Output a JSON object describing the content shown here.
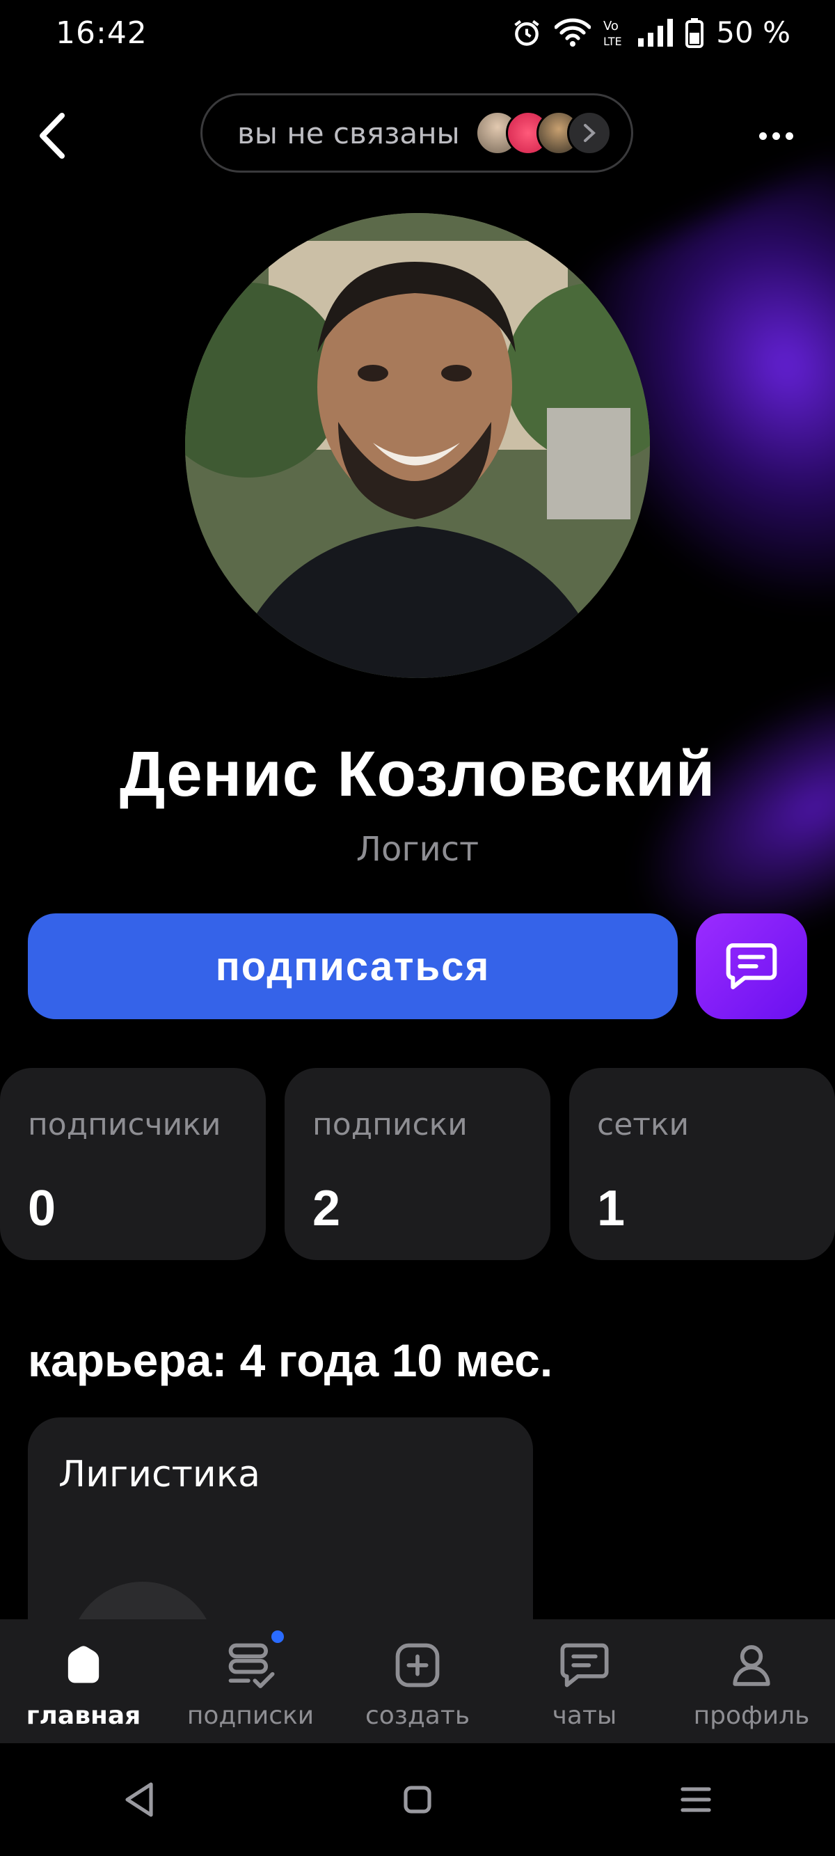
{
  "status_bar": {
    "time": "16:42",
    "battery": "50 %",
    "icons": [
      "alarm-icon",
      "wifi-icon",
      "volte-icon",
      "signal-icon",
      "battery-icon"
    ]
  },
  "header": {
    "connection_text": "вы не связаны",
    "icons": [
      "chevron-left-icon",
      "chevron-right-icon",
      "more-icon"
    ]
  },
  "profile": {
    "name": "Денис Козловский",
    "role": "Логист"
  },
  "actions": {
    "subscribe_label": "подписаться",
    "message_icon": "chat-bubble-icon",
    "subscribe_color": "#3563e9",
    "message_color": "#8a1cff"
  },
  "stats": [
    {
      "label": "подписчики",
      "value": "0"
    },
    {
      "label": "подписки",
      "value": "2"
    },
    {
      "label": "сетки",
      "value": "1"
    }
  ],
  "career": {
    "heading": "карьера: 4 года 10 мес.",
    "card_title": "Лигистика"
  },
  "bottom_nav": [
    {
      "label": "главная",
      "icon": "home-icon",
      "active": true
    },
    {
      "label": "подписки",
      "icon": "subscriptions-icon",
      "active": false,
      "has_dot": true
    },
    {
      "label": "создать",
      "icon": "plus-square-icon",
      "active": false
    },
    {
      "label": "чаты",
      "icon": "chat-icon",
      "active": false
    },
    {
      "label": "профиль",
      "icon": "user-icon",
      "active": false
    }
  ],
  "system_nav": [
    "back-triangle-icon",
    "home-square-icon",
    "recents-menu-icon"
  ]
}
